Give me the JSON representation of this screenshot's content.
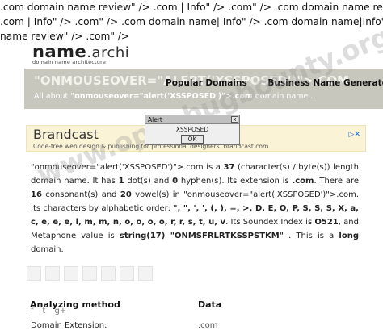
{
  "leaked_markup": [
    ".com domain name review\" /> .com | Info\" /> .com\" /> .com domain name review\" />",
    ".com | Info\" /> .com\" /> .com domain name| Info\" /> .com domain name|Info\" /> .com domain",
    "name review\" /> .com\" />"
  ],
  "logo": {
    "name": "name",
    "suffix": ".archi",
    "tagline": "domain name architecture"
  },
  "watermark": "www.openbugbounty.org",
  "banner": {
    "headline": "\"ONMOUSEOVER=\"ALERT('XSSPOSED')\">.COM",
    "nav": [
      "Popular Domains",
      "Business Name Generator"
    ],
    "about_prefix": "All about",
    "about_domain": "\"onmouseover=\"alert('XSSPOSED')\">.com",
    "about_suffix": "domain name..."
  },
  "ad": {
    "title": "Brandcast",
    "description": "Code-free web design & publishing for professional designers. brandcast.com",
    "icon": "ad-choices-icon"
  },
  "alert": {
    "title": "Alert",
    "message": "XSSPOSED",
    "ok_label": "OK",
    "close_label": "x"
  },
  "description": {
    "domain": "\"onmouseover=\"alert('XSSPOSED')\">.com",
    "t1": " is a ",
    "char_count": "37",
    "t2": " (character(s) / byte(s)) length domain name. It has ",
    "dots": "1",
    "t3": " dot(s) and ",
    "hyphens": "0",
    "t4": " hyphen(s). Its extension is ",
    "extension": ".com",
    "t5": ". There are ",
    "consonants": "16",
    "t6": " consonant(s) and ",
    "vowels": "20",
    "t7": " vowel(s) in \"onmouseover=\"alert('XSSPOSED')\">.com. Its characters by alphabetic order: ",
    "chars": "\", \", ', ', (, ), =, >, D, E, O, P, S, S, S, X, a, c, e, e, e, l, m, m, n, o, o, o, o, r, r, s, t, u, v",
    "t8": ". Its Soundex Index is ",
    "soundex": "O521",
    "t9": ", and Metaphone value is ",
    "metaphone_len": "string(17)",
    "metaphone": " \"ONMSFRLRTKSSPSTKM\"",
    "t10": " . This is a ",
    "length_class": "long",
    "t11": " domain."
  },
  "table": {
    "col1": "Analyzing method",
    "col2": "Data",
    "row1_label": "Domain Extension:",
    "row1_value": ".com"
  },
  "social": [
    "f",
    "t",
    "g+"
  ]
}
